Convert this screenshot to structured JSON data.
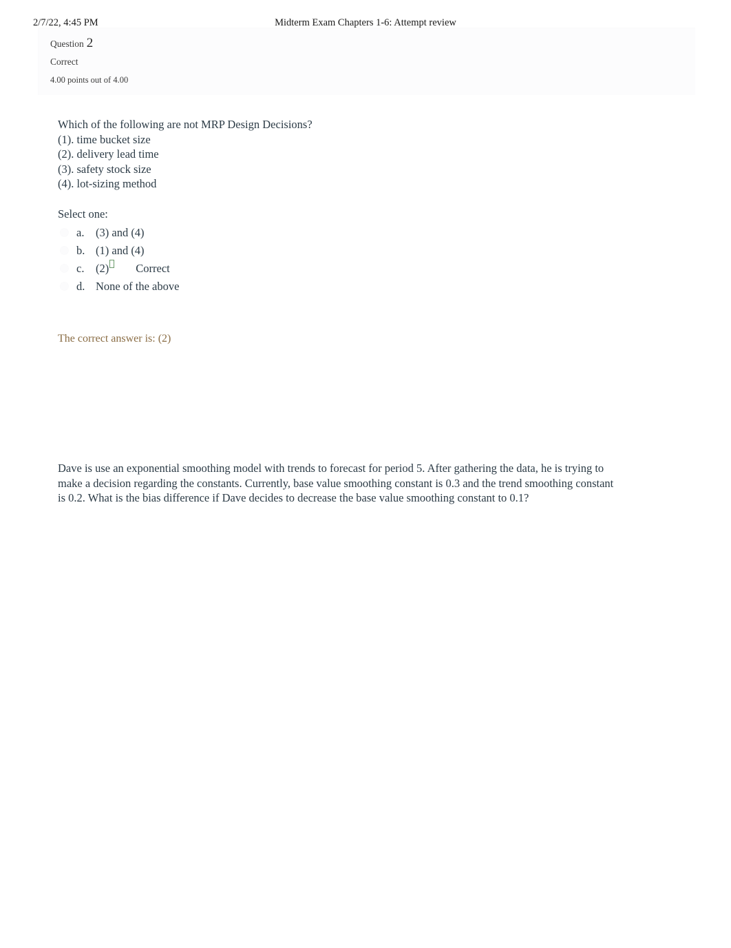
{
  "print_header": {
    "date": "2/7/22, 4:45 PM",
    "title": "Midterm Exam Chapters 1-6: Attempt review"
  },
  "question_info": {
    "label": "Question",
    "number": "2",
    "state": "Correct",
    "grade": "4.00 points out of 4.00"
  },
  "question": {
    "stem": "Which of the following are not MRP Design Decisions?",
    "items": [
      "(1). time bucket size",
      "(2). delivery lead time",
      "(3). safety stock size",
      "(4). lot-sizing method"
    ],
    "select_prompt": "Select one:",
    "answers": [
      {
        "letter": "a.",
        "text": "(3) and (4)",
        "selected": false,
        "marker": ""
      },
      {
        "letter": "b.",
        "text": "(1) and (4)",
        "selected": false,
        "marker": ""
      },
      {
        "letter": "c.",
        "text": "(2)",
        "selected": true,
        "marker": "Correct"
      },
      {
        "letter": "d.",
        "text": "None of the above",
        "selected": false,
        "marker": ""
      }
    ],
    "feedback": "The correct answer is: (2)"
  },
  "next_question": {
    "stem": "Dave is use an exponential smoothing model with trends to forecast for period 5. After gathering the data, he is trying to make a decision regarding the constants. Currently, base value smoothing constant is 0.3 and the trend smoothing constant is 0.2. What is the bias difference if Dave decides to decrease the base value smoothing constant to 0.1?"
  },
  "colors": {
    "body_text": "#2c3b46",
    "feedback_text": "#8a6d45",
    "tick_green": "#6a9a6a",
    "panel_bg": "#fcfcfd"
  }
}
